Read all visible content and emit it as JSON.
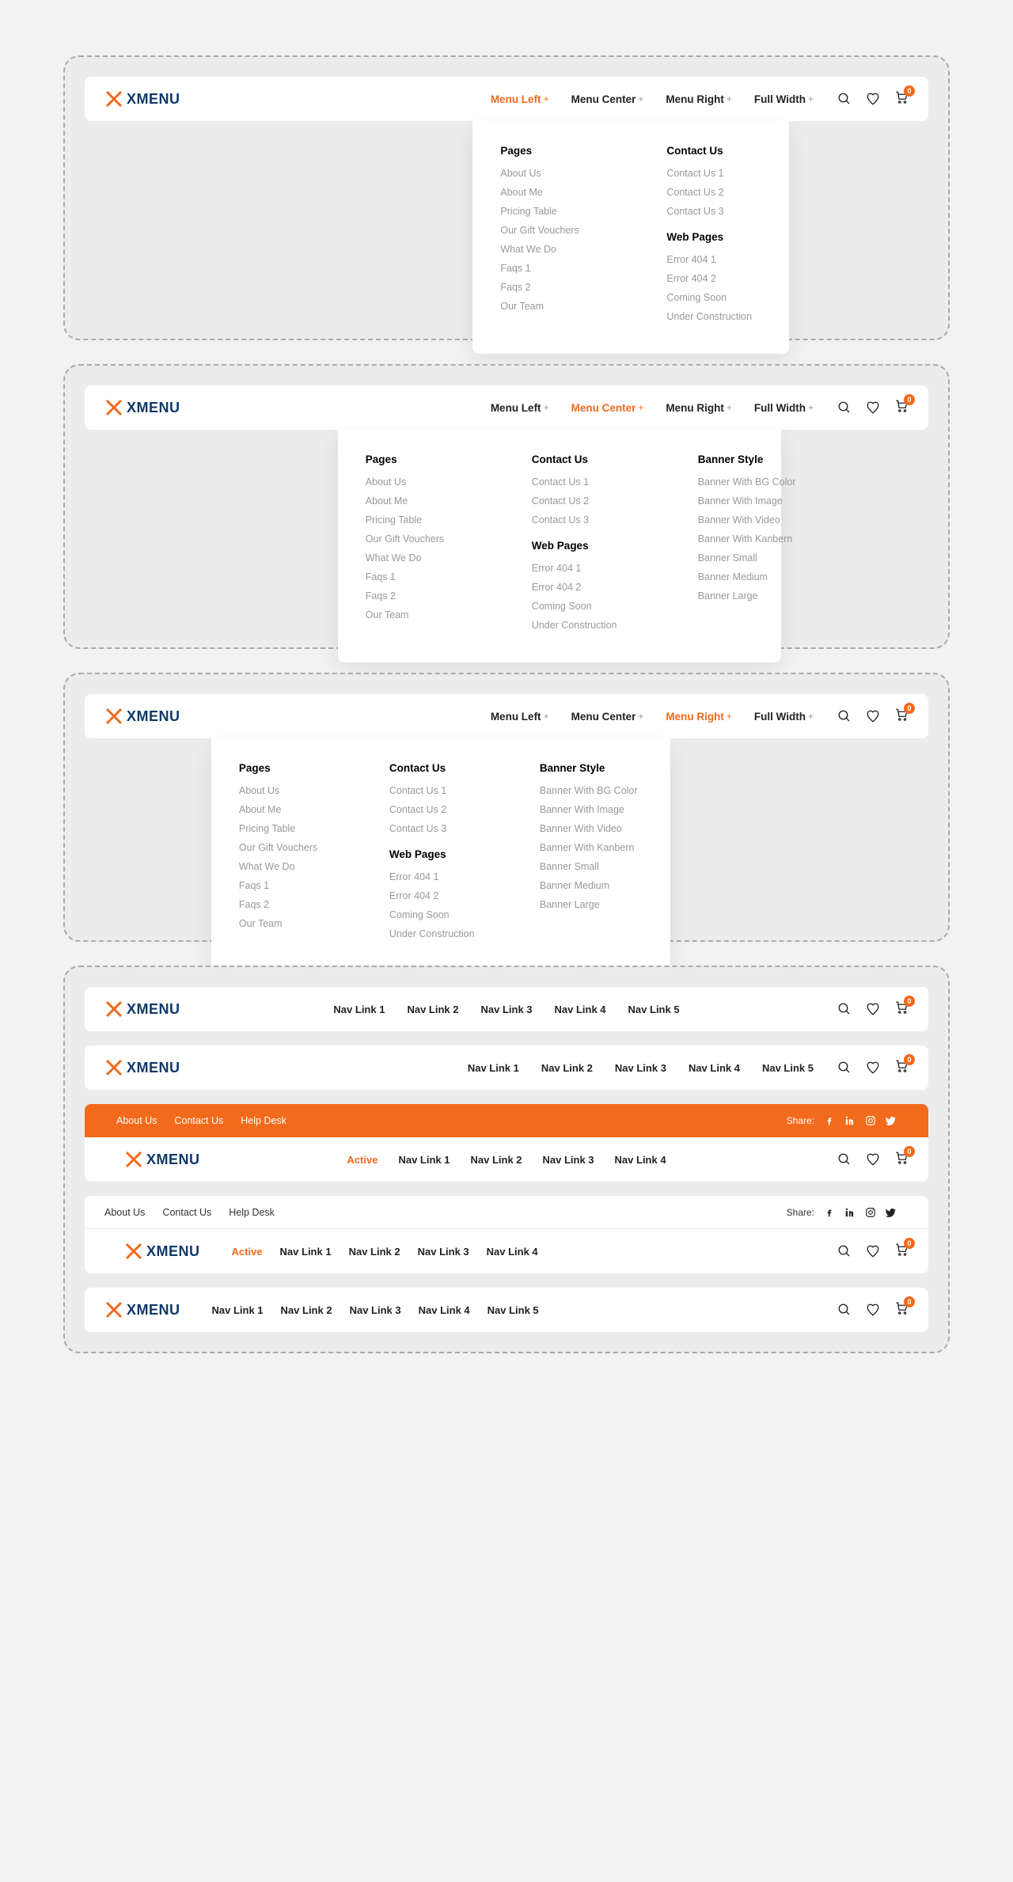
{
  "logo_text": "XMENU",
  "nav_items": [
    "Menu Left",
    "Menu Center",
    "Menu Right",
    "Full Width"
  ],
  "cart_count": "0",
  "dropdown_cols": {
    "pages": {
      "title": "Pages",
      "items": [
        "About Us",
        "About Me",
        "Pricing Table",
        "Our Gift Vouchers",
        "What We Do",
        "Faqs 1",
        "Faqs 2",
        "Our Team"
      ]
    },
    "contact": {
      "title": "Contact Us",
      "items": [
        "Contact Us 1",
        "Contact Us 2",
        "Contact Us 3"
      ],
      "sub_title": "Web Pages",
      "sub_items": [
        "Error 404 1",
        "Error 404 2",
        "Coming Soon",
        "Under Construction"
      ]
    },
    "banner": {
      "title": "Banner Style",
      "items": [
        "Banner With BG Color",
        "Banner With Image",
        "Banner With Video",
        "Banner With Kanbern",
        "Banner Small",
        "Banner Medium",
        "Banner Large"
      ]
    }
  },
  "simple_links_5": [
    "Nav Link 1",
    "Nav Link 2",
    "Nav Link 3",
    "Nav Link 4",
    "Nav Link 5"
  ],
  "simple_links_4": [
    "Nav Link 1",
    "Nav Link 2",
    "Nav Link 3",
    "Nav Link 4"
  ],
  "active_label": "Active",
  "topbar_links": [
    "About Us",
    "Contact Us",
    "Help Desk"
  ],
  "share_label": "Share:"
}
